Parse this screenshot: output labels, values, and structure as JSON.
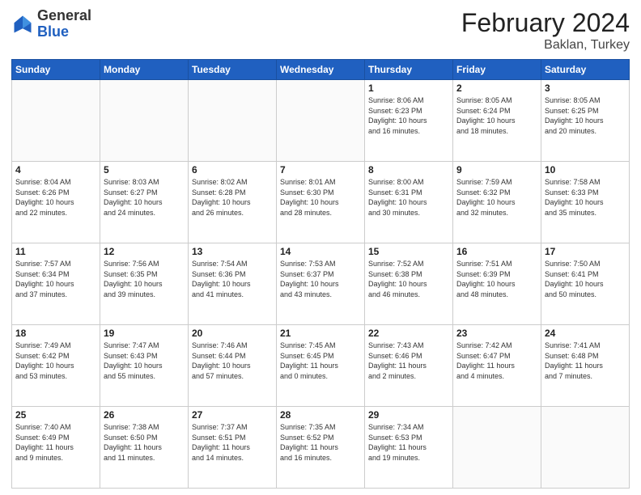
{
  "logo": {
    "general": "General",
    "blue": "Blue"
  },
  "title": "February 2024",
  "subtitle": "Baklan, Turkey",
  "days_of_week": [
    "Sunday",
    "Monday",
    "Tuesday",
    "Wednesday",
    "Thursday",
    "Friday",
    "Saturday"
  ],
  "weeks": [
    [
      {
        "day": "",
        "info": ""
      },
      {
        "day": "",
        "info": ""
      },
      {
        "day": "",
        "info": ""
      },
      {
        "day": "",
        "info": ""
      },
      {
        "day": "1",
        "info": "Sunrise: 8:06 AM\nSunset: 6:23 PM\nDaylight: 10 hours\nand 16 minutes."
      },
      {
        "day": "2",
        "info": "Sunrise: 8:05 AM\nSunset: 6:24 PM\nDaylight: 10 hours\nand 18 minutes."
      },
      {
        "day": "3",
        "info": "Sunrise: 8:05 AM\nSunset: 6:25 PM\nDaylight: 10 hours\nand 20 minutes."
      }
    ],
    [
      {
        "day": "4",
        "info": "Sunrise: 8:04 AM\nSunset: 6:26 PM\nDaylight: 10 hours\nand 22 minutes."
      },
      {
        "day": "5",
        "info": "Sunrise: 8:03 AM\nSunset: 6:27 PM\nDaylight: 10 hours\nand 24 minutes."
      },
      {
        "day": "6",
        "info": "Sunrise: 8:02 AM\nSunset: 6:28 PM\nDaylight: 10 hours\nand 26 minutes."
      },
      {
        "day": "7",
        "info": "Sunrise: 8:01 AM\nSunset: 6:30 PM\nDaylight: 10 hours\nand 28 minutes."
      },
      {
        "day": "8",
        "info": "Sunrise: 8:00 AM\nSunset: 6:31 PM\nDaylight: 10 hours\nand 30 minutes."
      },
      {
        "day": "9",
        "info": "Sunrise: 7:59 AM\nSunset: 6:32 PM\nDaylight: 10 hours\nand 32 minutes."
      },
      {
        "day": "10",
        "info": "Sunrise: 7:58 AM\nSunset: 6:33 PM\nDaylight: 10 hours\nand 35 minutes."
      }
    ],
    [
      {
        "day": "11",
        "info": "Sunrise: 7:57 AM\nSunset: 6:34 PM\nDaylight: 10 hours\nand 37 minutes."
      },
      {
        "day": "12",
        "info": "Sunrise: 7:56 AM\nSunset: 6:35 PM\nDaylight: 10 hours\nand 39 minutes."
      },
      {
        "day": "13",
        "info": "Sunrise: 7:54 AM\nSunset: 6:36 PM\nDaylight: 10 hours\nand 41 minutes."
      },
      {
        "day": "14",
        "info": "Sunrise: 7:53 AM\nSunset: 6:37 PM\nDaylight: 10 hours\nand 43 minutes."
      },
      {
        "day": "15",
        "info": "Sunrise: 7:52 AM\nSunset: 6:38 PM\nDaylight: 10 hours\nand 46 minutes."
      },
      {
        "day": "16",
        "info": "Sunrise: 7:51 AM\nSunset: 6:39 PM\nDaylight: 10 hours\nand 48 minutes."
      },
      {
        "day": "17",
        "info": "Sunrise: 7:50 AM\nSunset: 6:41 PM\nDaylight: 10 hours\nand 50 minutes."
      }
    ],
    [
      {
        "day": "18",
        "info": "Sunrise: 7:49 AM\nSunset: 6:42 PM\nDaylight: 10 hours\nand 53 minutes."
      },
      {
        "day": "19",
        "info": "Sunrise: 7:47 AM\nSunset: 6:43 PM\nDaylight: 10 hours\nand 55 minutes."
      },
      {
        "day": "20",
        "info": "Sunrise: 7:46 AM\nSunset: 6:44 PM\nDaylight: 10 hours\nand 57 minutes."
      },
      {
        "day": "21",
        "info": "Sunrise: 7:45 AM\nSunset: 6:45 PM\nDaylight: 11 hours\nand 0 minutes."
      },
      {
        "day": "22",
        "info": "Sunrise: 7:43 AM\nSunset: 6:46 PM\nDaylight: 11 hours\nand 2 minutes."
      },
      {
        "day": "23",
        "info": "Sunrise: 7:42 AM\nSunset: 6:47 PM\nDaylight: 11 hours\nand 4 minutes."
      },
      {
        "day": "24",
        "info": "Sunrise: 7:41 AM\nSunset: 6:48 PM\nDaylight: 11 hours\nand 7 minutes."
      }
    ],
    [
      {
        "day": "25",
        "info": "Sunrise: 7:40 AM\nSunset: 6:49 PM\nDaylight: 11 hours\nand 9 minutes."
      },
      {
        "day": "26",
        "info": "Sunrise: 7:38 AM\nSunset: 6:50 PM\nDaylight: 11 hours\nand 11 minutes."
      },
      {
        "day": "27",
        "info": "Sunrise: 7:37 AM\nSunset: 6:51 PM\nDaylight: 11 hours\nand 14 minutes."
      },
      {
        "day": "28",
        "info": "Sunrise: 7:35 AM\nSunset: 6:52 PM\nDaylight: 11 hours\nand 16 minutes."
      },
      {
        "day": "29",
        "info": "Sunrise: 7:34 AM\nSunset: 6:53 PM\nDaylight: 11 hours\nand 19 minutes."
      },
      {
        "day": "",
        "info": ""
      },
      {
        "day": "",
        "info": ""
      }
    ]
  ]
}
